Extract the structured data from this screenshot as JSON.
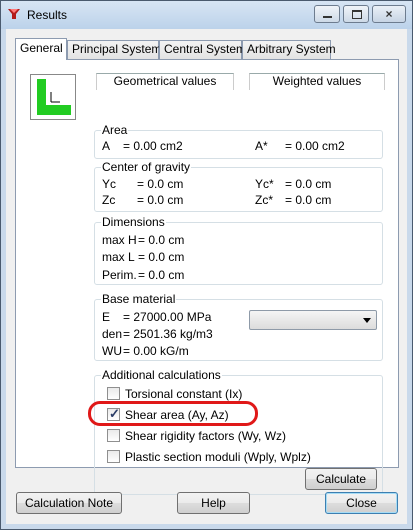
{
  "window": {
    "title": "Results"
  },
  "tabs": [
    "General",
    "Principal System",
    "Central System",
    "Arbitrary System"
  ],
  "headers": {
    "geometrical": "Geometrical values",
    "weighted": "Weighted values"
  },
  "area": {
    "title": "Area",
    "a_label": "A",
    "a_value": "= 0.00 cm2",
    "aw_label": "A*",
    "aw_value": "= 0.00 cm2"
  },
  "cog": {
    "title": "Center of gravity",
    "yc_label": "Yc",
    "yc_value": "= 0.0 cm",
    "ycw_label": "Yc*",
    "ycw_value": "= 0.0 cm",
    "zc_label": "Zc",
    "zc_value": "= 0.0 cm",
    "zcw_label": "Zc*",
    "zcw_value": "= 0.0 cm"
  },
  "dimensions": {
    "title": "Dimensions",
    "maxh_label": "max H",
    "maxh_value": "= 0.0 cm",
    "maxl_label": "max L",
    "maxl_value": "= 0.0 cm",
    "perim_label": "Perim.",
    "perim_value": "= 0.0 cm"
  },
  "material": {
    "title": "Base material",
    "e_label": "E",
    "e_value": "= 27000.00 MPa",
    "den_label": "den",
    "den_value": "= 2501.36 kg/m3",
    "wu_label": "WU",
    "wu_value": "= 0.00 kG/m",
    "combo_value": ""
  },
  "additional": {
    "title": "Additional calculations",
    "options": [
      {
        "label": "Torsional constant (Ix)",
        "checked": false
      },
      {
        "label": "Shear area (Ay, Az)",
        "checked": true
      },
      {
        "label": "Shear rigidity factors (Wy, Wz)",
        "checked": false
      },
      {
        "label": "Plastic section moduli (Wply, Wplz)",
        "checked": false
      }
    ],
    "calculate": "Calculate"
  },
  "footer": {
    "note": "Calculation Note",
    "help": "Help",
    "close": "Close"
  },
  "colors": {
    "profile": "#22cc22",
    "highlight": "#e01818"
  },
  "icons": {
    "close": "×",
    "check": "✓"
  }
}
